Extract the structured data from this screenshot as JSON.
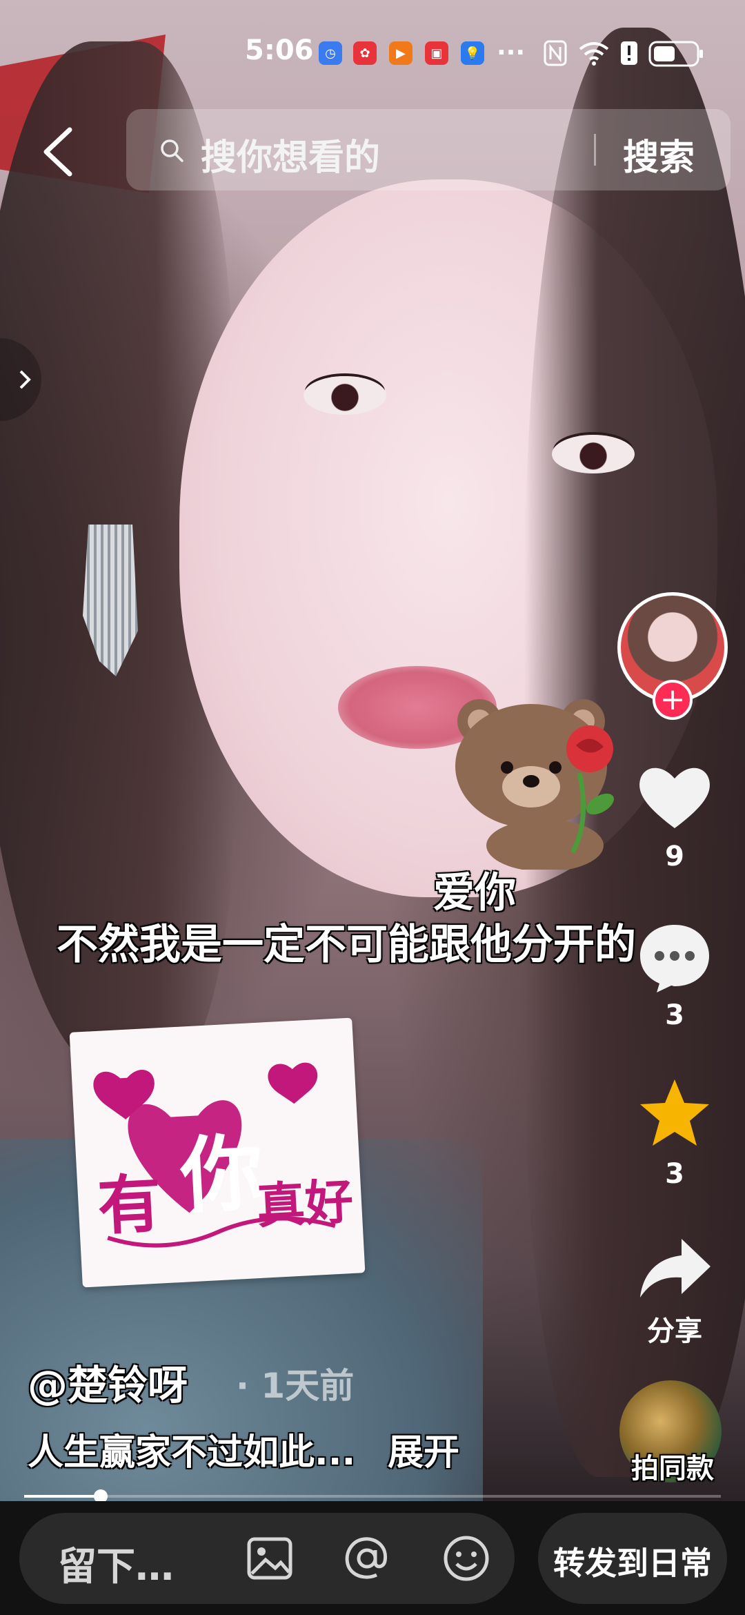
{
  "status_bar": {
    "time": "5:06",
    "app_icons": [
      "alarm-icon",
      "huawei-icon",
      "video-app-icon",
      "reader-app-icon",
      "bulb-icon"
    ],
    "overflow": "···",
    "system_icons": [
      "nfc-icon",
      "wifi-icon",
      "notification-icon",
      "battery-icon"
    ]
  },
  "search": {
    "placeholder": "搜你想看的",
    "button": "搜索"
  },
  "video": {
    "subtitle_top": "爱你",
    "subtitle": "不然我是一定不可能跟他分开的",
    "sticker_text_1": "有",
    "sticker_text_2": "你",
    "sticker_text_3": "真好",
    "progress": 0.11
  },
  "rail": {
    "likes": "9",
    "comments": "3",
    "favorites": "3",
    "share_label": "分享",
    "same_style_label": "拍同款"
  },
  "caption": {
    "author": "@楚铃呀",
    "time_ago": "· 1天前",
    "description": "人生赢家不过如此...",
    "expand": "展开"
  },
  "bottom_bar": {
    "comment_placeholder": "留下…",
    "share_daily": "转发到日常"
  },
  "colors": {
    "follow_accent": "#fe2c55",
    "favorite_star": "#f7b400",
    "sticker_pink": "#c2187b"
  }
}
